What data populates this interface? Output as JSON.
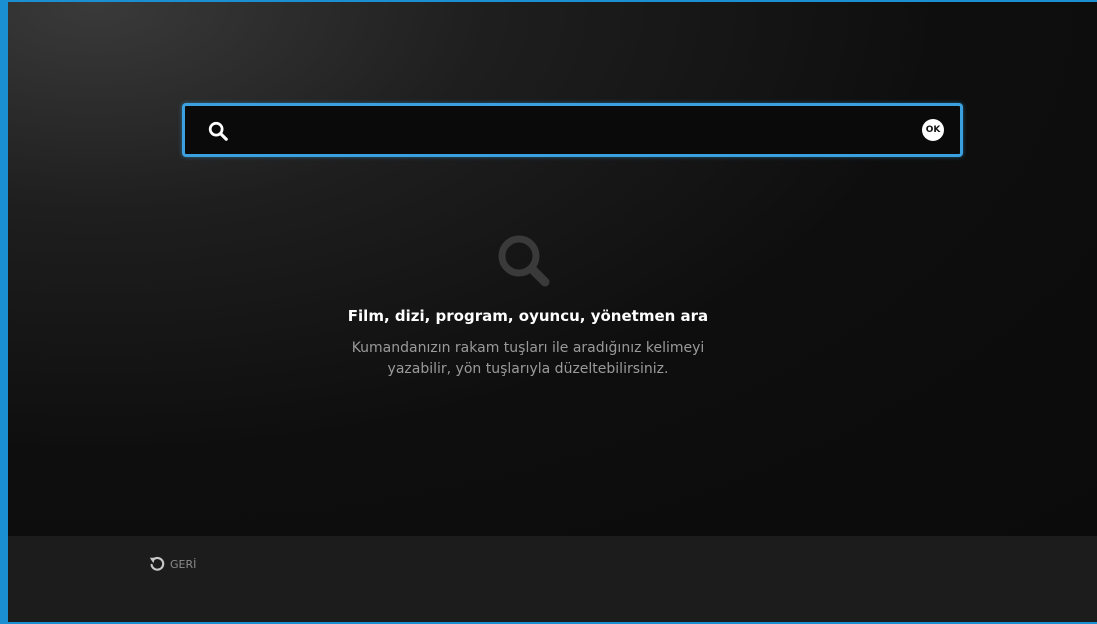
{
  "search": {
    "value": "",
    "placeholder": "",
    "ok_label": "OK"
  },
  "hint": {
    "title": "Film, dizi, program, oyuncu, yönetmen ara",
    "line1": "Kumandanızın rakam tuşları ile aradığınız kelimeyi",
    "line2": "yazabilir, yön tuşlarıyla düzeltebilirsiniz."
  },
  "footer": {
    "back_label": "GERİ"
  },
  "icons": {
    "search": "search-icon",
    "ok": "ok-badge-icon",
    "hint": "search-icon",
    "back": "back-arrow-icon"
  },
  "colors": {
    "accent": "#3aa0e0",
    "frame": "#1a8fd1",
    "background": "#0b0b0b",
    "footer": "#1c1c1c"
  }
}
